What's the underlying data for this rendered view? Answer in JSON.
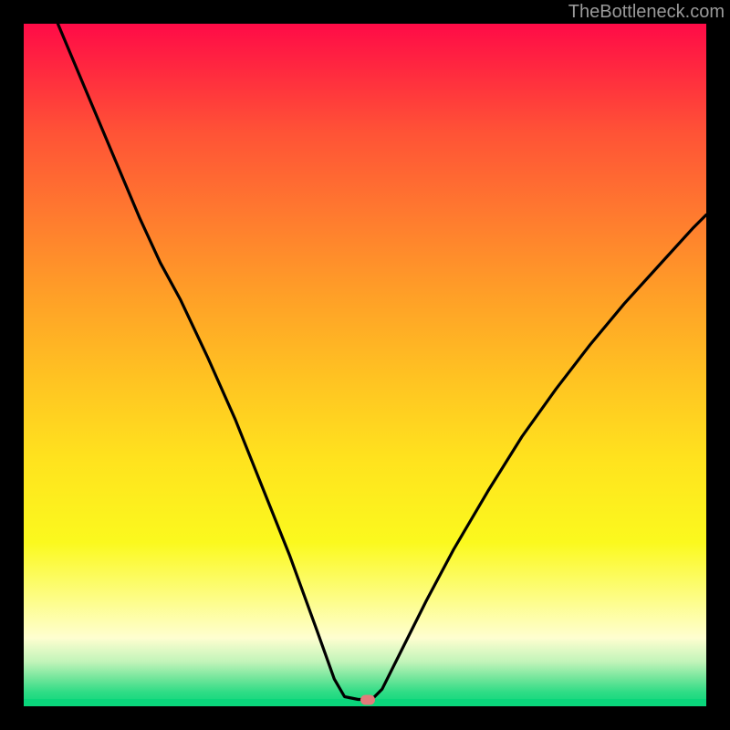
{
  "watermark": "TheBottleneck.com",
  "marker": {
    "x_pct": 50.4,
    "y_pct": 99.0
  },
  "chart_data": {
    "type": "line",
    "title": "",
    "xlabel": "",
    "ylabel": "",
    "xlim": [
      0,
      100
    ],
    "ylim": [
      0,
      100
    ],
    "grid": false,
    "legend": false,
    "annotations": [],
    "note": "Percentage x/y coordinates within plot area (0=left/top, 100=right/bottom). Values estimated from pixels; no numeric axes shown in image.",
    "series": [
      {
        "name": "bottleneck-curve",
        "points": [
          {
            "x": 5.0,
            "y": 0.0
          },
          {
            "x": 9.0,
            "y": 9.5
          },
          {
            "x": 13.0,
            "y": 19.0
          },
          {
            "x": 17.0,
            "y": 28.5
          },
          {
            "x": 20.0,
            "y": 35.0
          },
          {
            "x": 23.0,
            "y": 40.5
          },
          {
            "x": 27.0,
            "y": 49.0
          },
          {
            "x": 31.0,
            "y": 58.0
          },
          {
            "x": 35.0,
            "y": 68.0
          },
          {
            "x": 39.0,
            "y": 78.0
          },
          {
            "x": 43.0,
            "y": 89.0
          },
          {
            "x": 45.5,
            "y": 96.0
          },
          {
            "x": 47.0,
            "y": 98.6
          },
          {
            "x": 49.0,
            "y": 99.0
          },
          {
            "x": 51.0,
            "y": 99.0
          },
          {
            "x": 52.5,
            "y": 97.5
          },
          {
            "x": 55.0,
            "y": 92.5
          },
          {
            "x": 59.0,
            "y": 84.5
          },
          {
            "x": 63.0,
            "y": 77.0
          },
          {
            "x": 68.0,
            "y": 68.5
          },
          {
            "x": 73.0,
            "y": 60.5
          },
          {
            "x": 78.0,
            "y": 53.5
          },
          {
            "x": 83.0,
            "y": 47.0
          },
          {
            "x": 88.0,
            "y": 41.0
          },
          {
            "x": 93.0,
            "y": 35.5
          },
          {
            "x": 98.0,
            "y": 30.0
          },
          {
            "x": 100.0,
            "y": 28.0
          }
        ]
      }
    ],
    "background_gradient": {
      "orientation": "vertical",
      "stops": [
        {
          "pct": 0,
          "color": "#ff0b47"
        },
        {
          "pct": 16,
          "color": "#ff5336"
        },
        {
          "pct": 40,
          "color": "#ffa027"
        },
        {
          "pct": 64,
          "color": "#ffe31e"
        },
        {
          "pct": 84,
          "color": "#fdfd83"
        },
        {
          "pct": 93.5,
          "color": "#c1f4b9"
        },
        {
          "pct": 100,
          "color": "#0ad67b"
        }
      ]
    },
    "marker": {
      "x": 50.4,
      "y": 99.0,
      "color": "#e37b7b",
      "shape": "rounded-pill"
    }
  }
}
